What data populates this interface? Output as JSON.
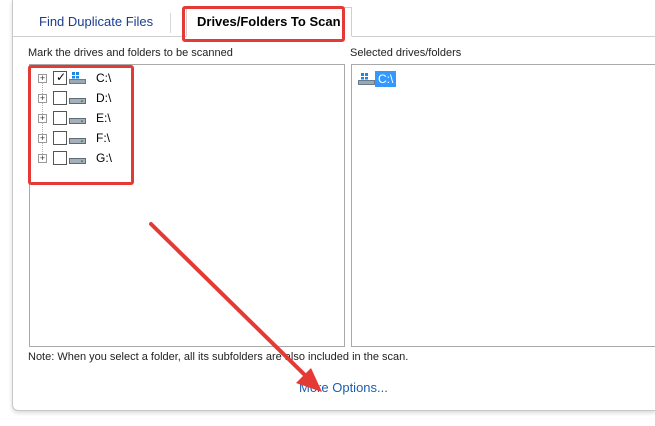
{
  "tabs": [
    {
      "label": "Find Duplicate Files",
      "active": false
    },
    {
      "label": "Drives/Folders To Scan",
      "active": true
    }
  ],
  "left_panel": {
    "label": "Mark the drives and folders to be scanned",
    "drives": [
      {
        "label": "C:\\",
        "checked": true,
        "icon": "windows-drive-icon"
      },
      {
        "label": "D:\\",
        "checked": false,
        "icon": "hard-drive-icon"
      },
      {
        "label": "E:\\",
        "checked": false,
        "icon": "hard-drive-icon"
      },
      {
        "label": "F:\\",
        "checked": false,
        "icon": "hard-drive-icon"
      },
      {
        "label": "G:\\",
        "checked": false,
        "icon": "hard-drive-icon"
      }
    ]
  },
  "right_panel": {
    "label": "Selected drives/folders",
    "items": [
      {
        "label": "C:\\",
        "icon": "windows-drive-icon"
      }
    ]
  },
  "note": "Note: When you select a folder, all its subfolders are also included in the scan.",
  "more_options": "More Options...",
  "colors": {
    "accent": "#1a5fb4",
    "highlight": "#e53935",
    "selection": "#3399ff"
  }
}
